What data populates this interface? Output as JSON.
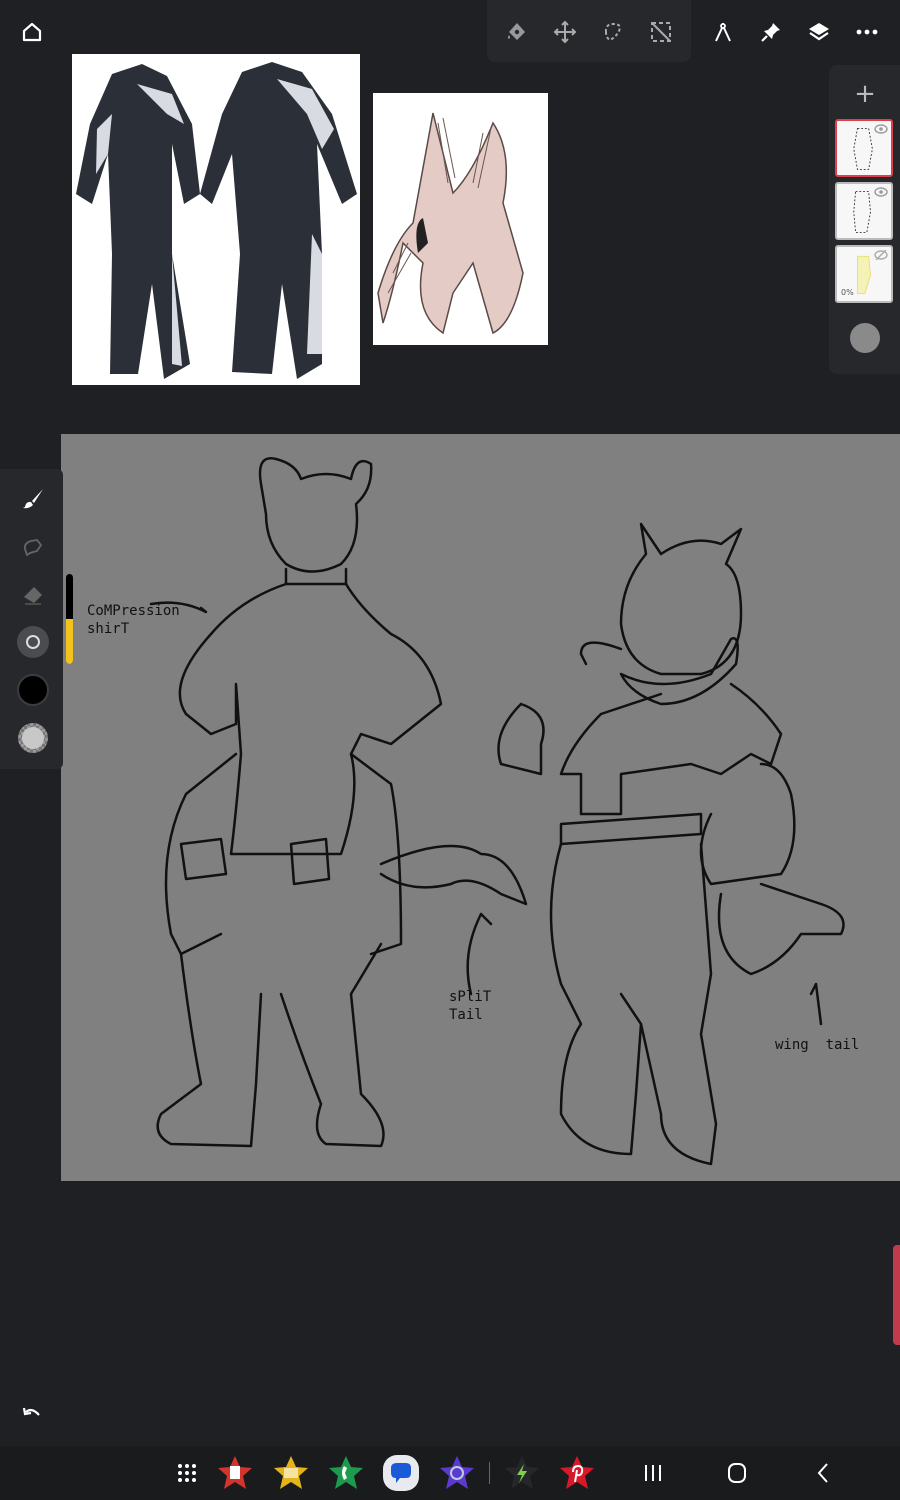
{
  "toolbar": {
    "home": "home-icon",
    "tools": [
      "fill-icon",
      "move-icon",
      "lasso-select-icon",
      "deselect-icon"
    ],
    "right": [
      "ruler-compass-icon",
      "pin-icon",
      "layers-icon",
      "more-icon"
    ]
  },
  "layers": {
    "add": "+",
    "items": [
      {
        "name": "layer-1",
        "visible": true,
        "active": true
      },
      {
        "name": "layer-2",
        "visible": true,
        "active": false
      },
      {
        "name": "layer-3",
        "visible": false,
        "active": false,
        "opacity_label": "0%"
      }
    ]
  },
  "left_tools": [
    "brush-icon",
    "smudge-icon",
    "eraser-icon",
    "brush-shape-icon",
    "color-black",
    "color-secondary"
  ],
  "brush": {
    "size_fraction": 0.5,
    "primary_color": "#000000",
    "secondary_color": "#c8c8c8",
    "slider_color": "#f4c21f"
  },
  "canvas": {
    "background": "#808080",
    "annotations": {
      "compression": "CoMPression\nshirT",
      "split_tail": "sPliT\nTail",
      "wing_tail": "wing  tail"
    }
  },
  "colors": {
    "accent_active_layer": "#e0404e"
  },
  "taskbar": {
    "apps": [
      "app-drawer",
      "google-docs",
      "google-keep-files",
      "phone",
      "messages",
      "internet",
      "lightning-app",
      "pinterest"
    ],
    "nav": [
      "recent-apps",
      "home",
      "back"
    ]
  }
}
